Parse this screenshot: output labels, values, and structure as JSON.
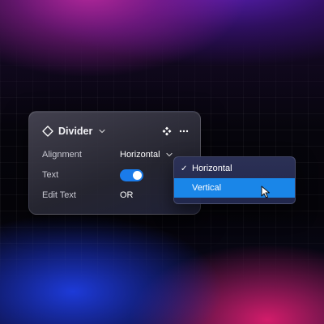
{
  "component": {
    "title": "Divider",
    "icons": [
      "component-diamond-icon",
      "chevron-down-icon",
      "component-set-icon",
      "more-icon"
    ]
  },
  "properties": [
    {
      "label": "Alignment",
      "value": "Horizontal",
      "control": "dropdown"
    },
    {
      "label": "Text",
      "value": true,
      "control": "toggle"
    },
    {
      "label": "Edit Text",
      "value": "OR",
      "control": "text"
    }
  ],
  "dropdown": {
    "options": [
      {
        "label": "Horizontal",
        "checked": true,
        "hovered": false
      },
      {
        "label": "Vertical",
        "checked": false,
        "hovered": true
      }
    ]
  },
  "colors": {
    "accent": "#1a86e8",
    "toggle_on": "#1a7bea"
  }
}
